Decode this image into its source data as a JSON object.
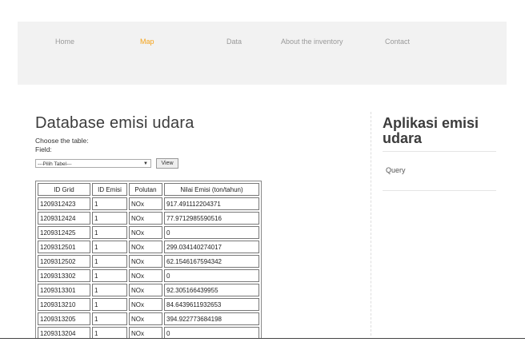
{
  "nav": {
    "items": [
      {
        "label": "Home",
        "active": false
      },
      {
        "label": "Map",
        "active": true
      },
      {
        "label": "Data",
        "active": false
      },
      {
        "label": "About the inventory",
        "active": false
      },
      {
        "label": "Contact",
        "active": false
      }
    ]
  },
  "main": {
    "title": "Database emisi udara",
    "choose_label": "Choose the table:",
    "field_label": "Field:",
    "select_value": "---Pilih Tabel---",
    "view_button": "View"
  },
  "table": {
    "headers": [
      "ID Grid",
      "ID Emisi",
      "Polutan",
      "Nilai Emisi (ton/tahun)"
    ],
    "rows": [
      [
        "1209312423",
        "1",
        "NOx",
        "917.491112204371"
      ],
      [
        "1209312424",
        "1",
        "NOx",
        "77.9712985590516"
      ],
      [
        "1209312425",
        "1",
        "NOx",
        "0"
      ],
      [
        "1209312501",
        "1",
        "NOx",
        "299.034140274017"
      ],
      [
        "1209312502",
        "1",
        "NOx",
        "62.1546167594342"
      ],
      [
        "1209313302",
        "1",
        "NOx",
        "0"
      ],
      [
        "1209313301",
        "1",
        "NOx",
        "92.305166439955"
      ],
      [
        "1209313210",
        "1",
        "NOx",
        "84.6439611932653"
      ],
      [
        "1209313205",
        "1",
        "NOx",
        "394.922773684198"
      ],
      [
        "1209313204",
        "1",
        "NOx",
        "0"
      ]
    ]
  },
  "sidebar": {
    "title": "Aplikasi emisi udara",
    "link": "Query"
  },
  "colors": {
    "nav_active": "#f5a31a",
    "nav_bg": "#f2f2f2"
  }
}
